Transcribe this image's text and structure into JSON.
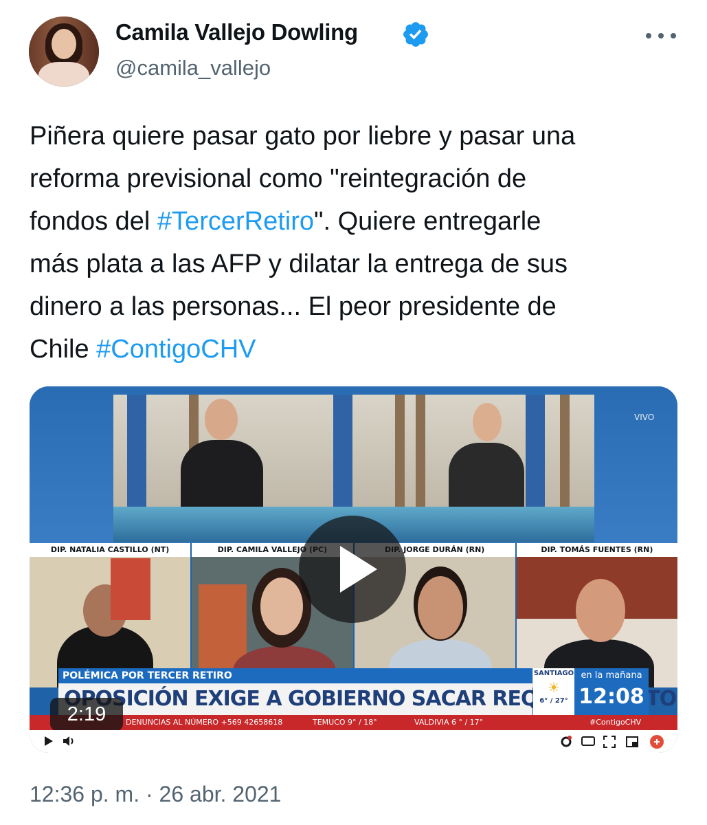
{
  "author": {
    "name": "Camila Vallejo Dowling",
    "handle": "@camila_vallejo",
    "verified": true
  },
  "tweet": {
    "lines": [
      [
        "Piñera quiere pasar gato por liebre y pasar una"
      ],
      [
        "reforma previsional como \"reintegración de"
      ],
      [
        "fondos del ",
        "#TercerRetiro",
        "\". Quiere entregarle"
      ],
      [
        "más plata a las AFP y dilatar la entrega de sus"
      ],
      [
        "dinero a las personas... El peor presidente de"
      ],
      [
        "Chile ",
        "#ContigoCHV"
      ]
    ],
    "text": {
      "l1": "Piñera quiere pasar gato por liebre y pasar una",
      "l2": "reforma previsional como \"reintegración de",
      "l3a": "fondos del ",
      "l3b": "#TercerRetiro",
      "l3c": "\". Quiere entregarle",
      "l4": "más plata a las AFP y dilatar la entrega de sus",
      "l5": "dinero a las personas... El peor presidente de",
      "l6a": "Chile ",
      "l6b": "#ContigoCHV"
    },
    "timestamp": "12:36 p. m. · 26 abr. 2021"
  },
  "video": {
    "duration": "2:19",
    "vivo": "VIVO",
    "panel_labels": [
      "DIP. NATALIA CASTILLO (NT)",
      "DIP. CAMILA VALLEJO (PC)",
      "DIP. JORGE DURÁN (RN)",
      "DIP. TOMÁS FUENTES (RN)"
    ],
    "lower_third_top": "POLÉMICA POR TERCER RETIRO",
    "lower_third_main": "OPOSICIÓN EXIGE A GOBIERNO SACAR REQUERIMIENTO EN TC",
    "weather_city": "SANTIAGO",
    "weather_temp": "6° / 27°",
    "clock_sub": "en la mañana",
    "clock_time": "12:08",
    "ticker": {
      "left": "DENUNCIAS AL NÚMERO +569 42658618",
      "mid1": "TEMUCO 9° / 18°",
      "mid2": "VALDIVIA 6 ° / 17°",
      "right": "#ContigoCHV"
    }
  },
  "icons": {
    "verified": "verified-badge-icon",
    "more": "more-options-icon",
    "play": "play-icon",
    "volume": "volume-icon",
    "fullscreen": "fullscreen-icon"
  },
  "colors": {
    "link": "#1d9bf0",
    "secondary_text": "#536471",
    "primary_text": "#0f1419",
    "verified": "#1d9bf0",
    "ticker": "#c8282a",
    "tv_blue": "#1d6bbf"
  }
}
